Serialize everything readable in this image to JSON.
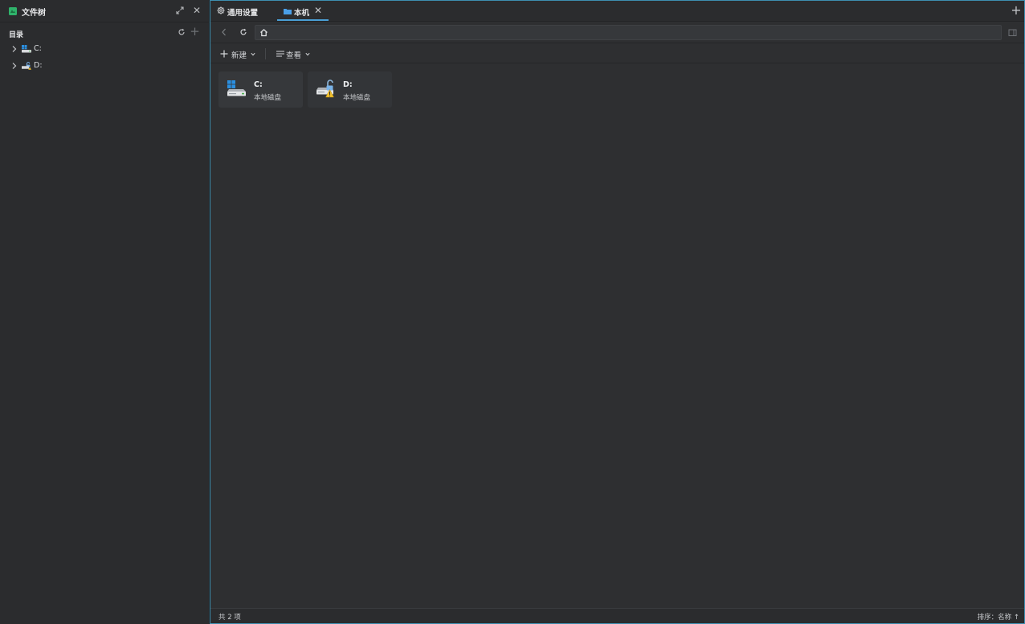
{
  "sidebar": {
    "title": "文件树",
    "directory_label": "目录",
    "tree": [
      {
        "label": "C:",
        "icon": "windows-drive-icon"
      },
      {
        "label": "D:",
        "icon": "unlocked-drive-warning-icon"
      }
    ]
  },
  "tabs": [
    {
      "label": "通用设置",
      "icon": "gear-icon"
    },
    {
      "label": "本机",
      "icon": "folder-icon",
      "active": true
    }
  ],
  "navigation": {
    "address": ""
  },
  "toolbar": {
    "new_label": "新建",
    "view_label": "查看"
  },
  "drives": [
    {
      "name": "C:",
      "type": "本地磁盘",
      "icon": "windows-drive-icon"
    },
    {
      "name": "D:",
      "type": "本地磁盘",
      "icon": "unlocked-drive-warning-icon"
    }
  ],
  "status": {
    "item_count": "共 2 项",
    "sort": "排序：名称 ↑"
  },
  "colors": {
    "accent": "#3d8fb0",
    "tab_underline": "#4a9fd4",
    "background": "#2e2f31",
    "sidebar_logo": "#2fb36b"
  }
}
